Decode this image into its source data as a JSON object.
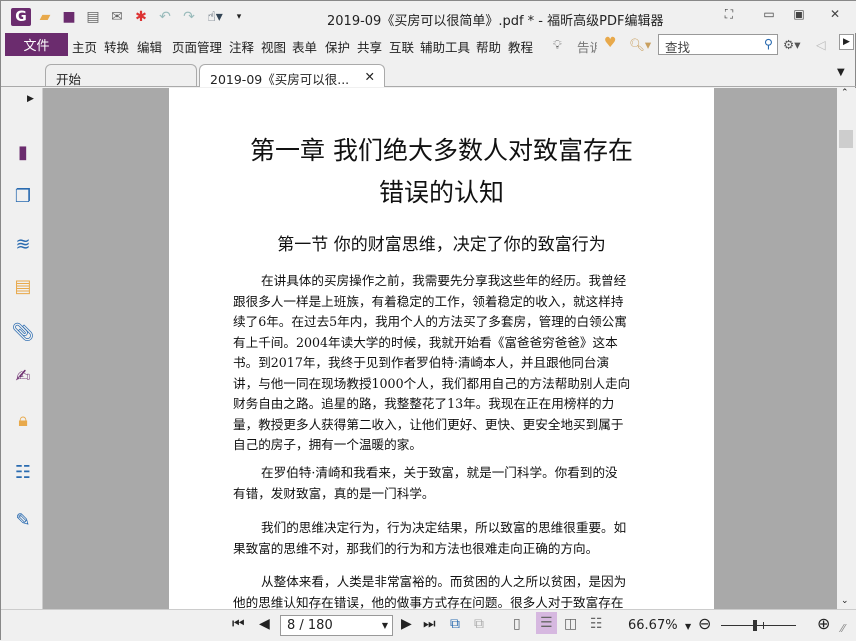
{
  "window": {
    "title": "2019-09《买房可以很简单》.pdf * - 福昕高级PDF编辑器"
  },
  "menu": {
    "file": "文件",
    "items": [
      "主页",
      "转换",
      "编辑",
      "页面管理",
      "注释",
      "视图",
      "表单",
      "保护",
      "共享",
      "互联",
      "辅助工具",
      "帮助",
      "教程"
    ],
    "tell_me": "告诉",
    "search_placeholder": "查找"
  },
  "tabs": [
    {
      "label": "开始"
    },
    {
      "label": "2019-09《买房可以很..."
    }
  ],
  "document": {
    "chapter_title": [
      "第一章 我们绝大多数人对致富存在",
      "错误的认知"
    ],
    "section_title": "第一节 你的财富思维，决定了你的致富行为",
    "paragraphs": [
      [
        "在讲具体的买房操作之前，我需要先分享我这些年的经历。我曾经",
        "跟很多人一样是上班族，有着稳定的工作，领着稳定的收入，就这样持",
        "续了6年。在过去5年内，我用个人的方法买了多套房，管理的白领公寓",
        "有上千间。2004年读大学的时候，我就开始看《富爸爸穷爸爸》这本",
        "书。到2017年，我终于见到作者罗伯特·清崎本人，并且跟他同台演",
        "讲，与他一同在现场教授1000个人，我们都用自己的方法帮助别人走向",
        "财务自由之路。追星的路，我整整花了13年。我现在正在用榜样的力",
        "量，教授更多人获得第二收入，让他们更好、更快、更安全地买到属于",
        "自己的房子，拥有一个温暖的家。"
      ],
      [
        "在罗伯特·清崎和我看来，关于致富，就是一门科学。你看到的没",
        "有错，发财致富，真的是一门科学。"
      ],
      [
        "我们的思维决定行为，行为决定结果，所以致富的思维很重要。如",
        "果致富的思维不对，那我们的行为和方法也很难走向正确的方向。"
      ],
      [
        "从整体来看，人类是非常富裕的。而贫困的人之所以贫困，是因为",
        "他的思维认知存在错误，他的做事方式存在问题。很多人对于致富存在"
      ]
    ]
  },
  "statusbar": {
    "page": "8 / 180",
    "zoom": "66.67%",
    "zoom_fraction": 0.45
  },
  "colors": {
    "brand": "#6b2c6e"
  }
}
